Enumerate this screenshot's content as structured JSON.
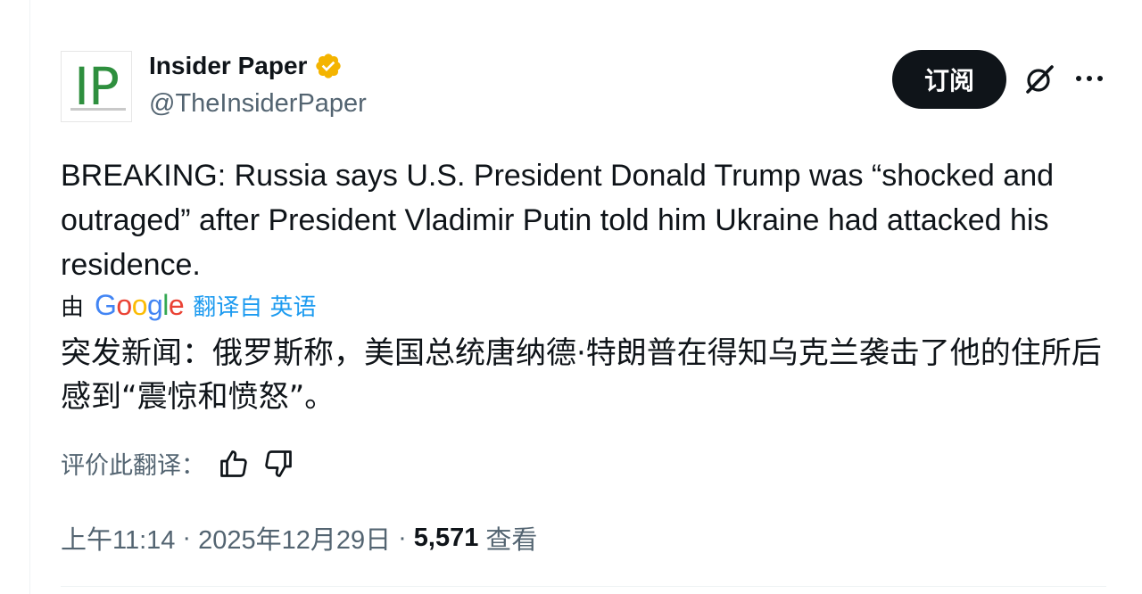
{
  "author": {
    "display_name": "Insider Paper",
    "handle": "@TheInsiderPaper",
    "avatar_text": "IP",
    "verified": true,
    "verified_color": "#f4b400"
  },
  "actions": {
    "subscribe_label": "订阅",
    "grok_icon": "grok-icon",
    "more_icon": "more-icon"
  },
  "tweet": {
    "text": "BREAKING: Russia says U.S. President Donald Trump was “shocked and outraged” after President Vladimir Putin told him Ukraine had attacked his residence."
  },
  "translation": {
    "by_label": "由",
    "provider": "Google",
    "from_label": "翻译自 英语",
    "text": "突发新闻：俄罗斯称，美国总统唐纳德·特朗普在得知乌克兰袭击了他的住所后感到“震惊和愤怒”。",
    "rate_label": "评价此翻译："
  },
  "meta": {
    "time": "上午11:14",
    "date": "2025年12月29日",
    "views_count": "5,571",
    "views_label": "查看",
    "separator": "·"
  },
  "colors": {
    "text_primary": "#0f1419",
    "text_secondary": "#536471",
    "link": "#1d9bf0",
    "button_bg": "#0f1419"
  }
}
